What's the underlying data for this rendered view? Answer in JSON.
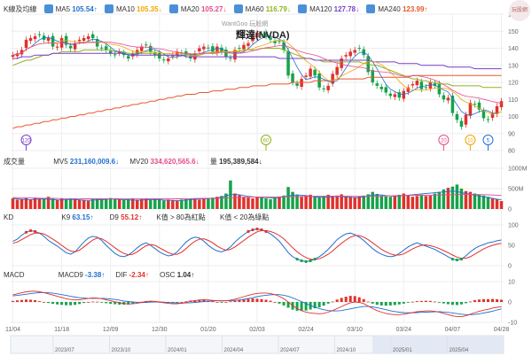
{
  "header": {
    "kline_label": "K線及均線",
    "ma": [
      {
        "label": "MA5",
        "value": "105.54↑",
        "color": "#1f6fd1"
      },
      {
        "label": "MA10",
        "value": "105.35↓",
        "color": "#f0a500"
      },
      {
        "label": "MA20",
        "value": "105.27↓",
        "color": "#e64a8b"
      },
      {
        "label": "MA60",
        "value": "116.79↓",
        "color": "#8fb21c"
      },
      {
        "label": "MA120",
        "value": "127.78↓",
        "color": "#7a3fc9"
      },
      {
        "label": "MA240",
        "value": "123.99↑",
        "color": "#e8582c"
      }
    ],
    "watermark": "WantGoo 玩股網",
    "stock_name": "輝達(NVDA)"
  },
  "volume_panel": {
    "label": "成交量",
    "mv5_label": "MV5",
    "mv5_value": "231,160,009.6↓",
    "mv20_label": "MV20",
    "mv20_value": "334,620,565.6↓",
    "qty_label": "量",
    "qty_value": "195,389,584↓"
  },
  "kd_panel": {
    "label": "KD",
    "k_label": "K9",
    "k_value": "63.15↑",
    "d_label": "D9",
    "d_value": "55.12↑",
    "note1": "K值 > 80為紅點",
    "note2": "K值 < 20為綠點"
  },
  "macd_panel": {
    "label": "MACD",
    "macd_label": "MACD9",
    "macd_value": "-3.38↑",
    "dif_label": "DIF",
    "dif_value": "-2.34↑",
    "osc_label": "OSC",
    "osc_value": "1.04↑"
  },
  "colors": {
    "up": "#e0312b",
    "down": "#16a34a",
    "k": "#1f6fd1",
    "d": "#e0312b",
    "grid": "#eeeeee"
  },
  "chart_data": {
    "type": "candlestick",
    "x_ticks": [
      "11/04",
      "11/18",
      "12/09",
      "12/30",
      "01/20",
      "02/03",
      "02/24",
      "03/10",
      "03/24",
      "04/07",
      "04/28"
    ],
    "nav_ticks": [
      "2023/07",
      "2023/10",
      "2024/01",
      "2024/04",
      "2024/07",
      "2024/10",
      "2025/01",
      "2025/04"
    ],
    "price_axis": {
      "ylim": [
        80,
        160
      ],
      "ticks": [
        80,
        90,
        100,
        110,
        120,
        130,
        140,
        150,
        160
      ]
    },
    "volume_axis": {
      "ylim": [
        0,
        1000000000
      ],
      "ticks": [
        "0",
        "500M",
        "1000M"
      ]
    },
    "kd_axis": {
      "ylim": [
        0,
        100
      ],
      "ticks": [
        0,
        50,
        100
      ]
    },
    "macd_axis": {
      "ylim": [
        -10,
        10
      ],
      "ticks": [
        -10,
        0,
        10
      ]
    },
    "close": [
      136,
      137,
      139,
      145,
      146,
      147,
      148,
      145,
      146,
      141,
      141,
      146,
      142,
      140,
      143,
      145,
      146,
      147,
      146,
      141,
      140,
      139,
      137,
      136,
      138,
      136,
      134,
      137,
      139,
      141,
      142,
      138,
      136,
      134,
      133,
      134,
      136,
      138,
      137,
      136,
      134,
      137,
      140,
      141,
      140,
      138,
      141,
      138,
      135,
      134,
      139,
      140,
      142,
      143,
      147,
      149,
      148,
      147,
      145,
      143,
      144,
      139,
      124,
      120,
      118,
      122,
      124,
      128,
      124,
      117,
      116,
      118,
      125,
      129,
      134,
      136,
      138,
      139,
      140,
      136,
      126,
      120,
      118,
      116,
      114,
      112,
      113,
      111,
      115,
      117,
      119,
      121,
      116,
      117,
      120,
      118,
      113,
      110,
      111,
      102,
      98,
      94,
      101,
      108,
      107,
      104,
      99,
      98,
      102,
      106,
      109
    ],
    "mv5_series": [
      260,
      250,
      240,
      230,
      230,
      240,
      250,
      245,
      240,
      235,
      225,
      220,
      230,
      240,
      235,
      225,
      215,
      210,
      220,
      225,
      230,
      240,
      250,
      245,
      235,
      230,
      225,
      220,
      215,
      220,
      225,
      230,
      235,
      230,
      220,
      215,
      210,
      205,
      210,
      220,
      230,
      240,
      245,
      250,
      255,
      260,
      270,
      290,
      320,
      350,
      360,
      350,
      330,
      310,
      300,
      290,
      285,
      280,
      275,
      270,
      280,
      300,
      320,
      340,
      345,
      340,
      330,
      310,
      300,
      290,
      285,
      290,
      300,
      310,
      305,
      295,
      285,
      280,
      285,
      300,
      320,
      340,
      350,
      345,
      330,
      320,
      315,
      320,
      330,
      340,
      350,
      360,
      370,
      380,
      390,
      400,
      410,
      420,
      430,
      440,
      430,
      400,
      380,
      360,
      340,
      320,
      300,
      280,
      260,
      240,
      231
    ],
    "mv20_series": [
      280,
      278,
      275,
      272,
      270,
      268,
      266,
      264,
      262,
      260,
      258,
      256,
      255,
      254,
      253,
      252,
      251,
      250,
      250,
      250,
      250,
      251,
      252,
      253,
      254,
      255,
      255,
      255,
      254,
      253,
      252,
      251,
      250,
      249,
      248,
      248,
      248,
      249,
      250,
      252,
      254,
      256,
      258,
      260,
      262,
      264,
      266,
      268,
      272,
      276,
      280,
      284,
      288,
      290,
      292,
      293,
      294,
      295,
      296,
      297,
      298,
      300,
      302,
      304,
      306,
      308,
      310,
      311,
      312,
      312,
      312,
      313,
      314,
      314,
      314,
      313,
      312,
      311,
      311,
      312,
      314,
      316,
      318,
      320,
      322,
      324,
      326,
      328,
      330,
      332,
      334,
      336,
      338,
      340,
      342,
      344,
      346,
      348,
      350,
      352,
      354,
      356,
      358,
      358,
      357,
      355,
      352,
      348,
      344,
      340,
      335
    ],
    "volume_values": [
      260,
      230,
      250,
      270,
      240,
      280,
      250,
      260,
      300,
      260,
      220,
      260,
      230,
      240,
      260,
      230,
      220,
      200,
      240,
      260,
      230,
      250,
      270,
      240,
      230,
      220,
      240,
      260,
      230,
      240,
      250,
      220,
      240,
      230,
      210,
      230,
      220,
      200,
      230,
      240,
      250,
      260,
      230,
      240,
      260,
      280,
      300,
      320,
      380,
      700,
      380,
      340,
      300,
      280,
      260,
      300,
      280,
      260,
      240,
      280,
      300,
      330,
      540,
      420,
      350,
      300,
      330,
      350,
      310,
      300,
      320,
      350,
      320,
      330,
      360,
      310,
      300,
      290,
      310,
      330,
      360,
      420,
      370,
      330,
      310,
      300,
      320,
      350,
      380,
      330,
      300,
      320,
      350,
      320,
      330,
      380,
      420,
      480,
      520,
      550,
      600,
      500,
      440,
      420,
      380,
      350,
      330,
      300,
      260,
      240,
      195
    ],
    "k_series": [
      60,
      65,
      75,
      82,
      86,
      84,
      80,
      72,
      62,
      55,
      48,
      40,
      32,
      28,
      34,
      46,
      58,
      68,
      72,
      70,
      62,
      50,
      40,
      30,
      24,
      22,
      26,
      34,
      44,
      52,
      56,
      50,
      42,
      34,
      28,
      24,
      26,
      34,
      46,
      58,
      66,
      70,
      68,
      60,
      50,
      42,
      36,
      34,
      38,
      46,
      58,
      68,
      76,
      84,
      88,
      90,
      88,
      84,
      78,
      70,
      60,
      46,
      32,
      22,
      16,
      12,
      10,
      12,
      16,
      22,
      30,
      40,
      52,
      64,
      72,
      78,
      80,
      76,
      70,
      62,
      52,
      42,
      34,
      28,
      24,
      22,
      24,
      30,
      38,
      46,
      52,
      56,
      52,
      48,
      44,
      40,
      34,
      28,
      22,
      16,
      14,
      16,
      24,
      34,
      42,
      48,
      52,
      56,
      58,
      61,
      63
    ],
    "d_series": [
      55,
      58,
      64,
      70,
      76,
      80,
      80,
      78,
      72,
      65,
      58,
      50,
      42,
      36,
      34,
      38,
      46,
      55,
      63,
      68,
      66,
      60,
      52,
      44,
      36,
      30,
      27,
      28,
      34,
      42,
      49,
      52,
      50,
      44,
      38,
      32,
      28,
      28,
      33,
      42,
      52,
      60,
      65,
      66,
      62,
      56,
      48,
      42,
      38,
      40,
      46,
      54,
      62,
      70,
      77,
      83,
      86,
      86,
      84,
      80,
      74,
      66,
      55,
      44,
      34,
      26,
      20,
      16,
      15,
      17,
      22,
      28,
      36,
      46,
      55,
      63,
      70,
      74,
      74,
      70,
      64,
      56,
      48,
      40,
      34,
      29,
      26,
      26,
      29,
      35,
      41,
      46,
      50,
      51,
      49,
      46,
      42,
      37,
      32,
      26,
      21,
      18,
      18,
      22,
      28,
      35,
      41,
      46,
      50,
      53,
      55
    ],
    "dif_series": [
      3.5,
      4.0,
      4.5,
      5.0,
      5.2,
      5.3,
      5.0,
      4.6,
      4.0,
      3.4,
      2.8,
      2.2,
      1.6,
      1.2,
      1.0,
      1.1,
      1.4,
      1.8,
      2.0,
      1.9,
      1.6,
      1.1,
      0.6,
      0.1,
      -0.4,
      -0.8,
      -1.0,
      -0.9,
      -0.6,
      -0.2,
      0.2,
      0.4,
      0.3,
      0.0,
      -0.4,
      -0.7,
      -0.9,
      -0.9,
      -0.6,
      -0.2,
      0.3,
      0.7,
      1.0,
      1.1,
      1.0,
      0.8,
      0.6,
      0.5,
      0.6,
      0.9,
      1.4,
      2.0,
      2.6,
      3.2,
      3.8,
      4.2,
      4.4,
      4.4,
      4.1,
      3.6,
      2.8,
      1.6,
      0.0,
      -1.8,
      -3.2,
      -4.2,
      -5.0,
      -5.4,
      -5.6,
      -5.8,
      -5.6,
      -5.0,
      -4.2,
      -3.2,
      -2.2,
      -1.2,
      -0.4,
      0.0,
      -0.2,
      -0.8,
      -2.0,
      -3.2,
      -4.2,
      -5.0,
      -5.6,
      -6.0,
      -6.2,
      -6.2,
      -6.0,
      -5.6,
      -5.2,
      -4.8,
      -4.6,
      -4.4,
      -4.4,
      -4.6,
      -5.0,
      -5.6,
      -6.2,
      -6.8,
      -7.2,
      -7.2,
      -6.8,
      -6.0,
      -5.2,
      -4.6,
      -4.0,
      -3.6,
      -3.0,
      -2.6,
      -2.3
    ],
    "macd_series": [
      3.0,
      3.2,
      3.5,
      3.8,
      4.1,
      4.4,
      4.6,
      4.6,
      4.5,
      4.3,
      4.0,
      3.6,
      3.2,
      2.8,
      2.4,
      2.1,
      1.9,
      1.8,
      1.8,
      1.8,
      1.8,
      1.7,
      1.5,
      1.2,
      0.9,
      0.5,
      0.2,
      0.0,
      -0.2,
      -0.3,
      -0.2,
      -0.1,
      0.0,
      0.0,
      -0.1,
      -0.3,
      -0.4,
      -0.5,
      -0.6,
      -0.5,
      -0.4,
      -0.2,
      0.0,
      0.2,
      0.4,
      0.5,
      0.6,
      0.6,
      0.6,
      0.6,
      0.8,
      1.0,
      1.3,
      1.7,
      2.1,
      2.6,
      3.0,
      3.3,
      3.5,
      3.6,
      3.6,
      3.3,
      2.8,
      2.0,
      1.1,
      0.2,
      -0.8,
      -1.7,
      -2.5,
      -3.2,
      -3.8,
      -4.2,
      -4.4,
      -4.4,
      -4.2,
      -3.8,
      -3.4,
      -2.9,
      -2.5,
      -2.2,
      -2.2,
      -2.4,
      -2.8,
      -3.3,
      -3.8,
      -4.3,
      -4.7,
      -5.0,
      -5.2,
      -5.3,
      -5.3,
      -5.2,
      -5.1,
      -5.0,
      -4.9,
      -4.8,
      -4.8,
      -4.9,
      -5.1,
      -5.4,
      -5.7,
      -6.0,
      -6.2,
      -6.2,
      -6.1,
      -5.8,
      -5.4,
      -5.0,
      -4.5,
      -3.9,
      -3.4
    ],
    "ma_lines": {
      "MA60": [
        130,
        131,
        132,
        133,
        133,
        134,
        135,
        136,
        136,
        137,
        137,
        138,
        138,
        138,
        138,
        138,
        139,
        139,
        139,
        139,
        139,
        139,
        139,
        138,
        138,
        138,
        137,
        137,
        137,
        137,
        137,
        137,
        137,
        136,
        136,
        136,
        136,
        136,
        136,
        136,
        136,
        136,
        136,
        137,
        137,
        137,
        137,
        138,
        138,
        138,
        138,
        138,
        139,
        139,
        139,
        139,
        140,
        140,
        140,
        140,
        140,
        139,
        138,
        137,
        136,
        135,
        134,
        134,
        133,
        133,
        132,
        132,
        132,
        132,
        132,
        132,
        132,
        132,
        132,
        131,
        131,
        130,
        130,
        129,
        128,
        127,
        126,
        125,
        124,
        123,
        122,
        122,
        121,
        121,
        120,
        120,
        119,
        119,
        119,
        118,
        118,
        118,
        118,
        118,
        118,
        118,
        117,
        117,
        117,
        117,
        117
      ],
      "MA120": [
        134,
        134,
        135,
        135,
        135,
        136,
        136,
        136,
        136,
        137,
        137,
        137,
        137,
        137,
        137,
        137,
        137,
        137,
        137,
        137,
        137,
        137,
        137,
        137,
        137,
        137,
        136,
        136,
        136,
        136,
        136,
        136,
        136,
        136,
        136,
        136,
        136,
        136,
        136,
        135,
        135,
        135,
        135,
        135,
        135,
        135,
        135,
        135,
        135,
        135,
        135,
        135,
        135,
        135,
        135,
        135,
        135,
        135,
        135,
        135,
        134,
        134,
        134,
        134,
        134,
        134,
        134,
        134,
        133,
        133,
        133,
        133,
        133,
        133,
        133,
        133,
        133,
        133,
        133,
        133,
        133,
        132,
        132,
        132,
        132,
        132,
        132,
        131,
        131,
        131,
        131,
        131,
        130,
        130,
        130,
        130,
        130,
        130,
        129,
        129,
        129,
        129,
        129,
        129,
        128,
        128,
        128,
        128,
        128,
        128,
        128
      ],
      "MA240": [
        93,
        94,
        94,
        95,
        95,
        96,
        96,
        97,
        97,
        98,
        98,
        99,
        99,
        100,
        100,
        101,
        101,
        102,
        102,
        103,
        103,
        104,
        104,
        105,
        105,
        106,
        106,
        107,
        107,
        108,
        108,
        109,
        109,
        110,
        110,
        111,
        111,
        112,
        112,
        113,
        113,
        113,
        114,
        114,
        114,
        115,
        115,
        115,
        116,
        116,
        116,
        117,
        117,
        117,
        118,
        118,
        118,
        118,
        119,
        119,
        119,
        119,
        119,
        120,
        120,
        120,
        120,
        120,
        121,
        121,
        121,
        121,
        121,
        122,
        122,
        122,
        122,
        122,
        122,
        122,
        123,
        123,
        123,
        123,
        123,
        123,
        123,
        123,
        123,
        123,
        124,
        124,
        124,
        124,
        124,
        124,
        124,
        124,
        124,
        124,
        124,
        124,
        124,
        124,
        124,
        124,
        124,
        124,
        124,
        124,
        124
      ]
    },
    "markers": [
      {
        "label": "120",
        "index": 3,
        "color": "#7a3fc9"
      },
      {
        "label": "60",
        "index": 57,
        "color": "#8fb21c"
      },
      {
        "label": "20",
        "index": 97,
        "color": "#e64a8b"
      },
      {
        "label": "10",
        "index": 103,
        "color": "#f0a500"
      },
      {
        "label": "5",
        "index": 107,
        "color": "#1f6fd1"
      }
    ]
  }
}
